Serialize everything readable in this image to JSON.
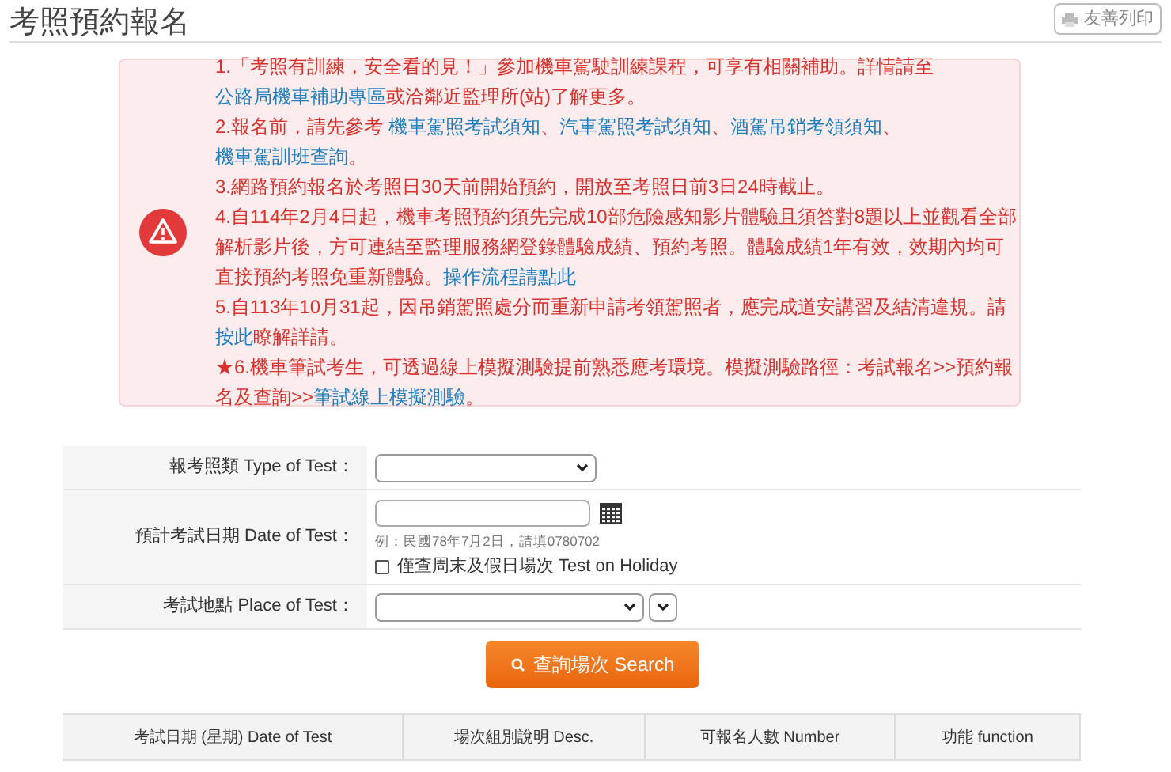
{
  "page": {
    "title": "考照預約報名",
    "print_button": "友善列印"
  },
  "notices": [
    [
      {
        "kind": "text",
        "text": "1.「考照有訓練，安全看的見！」參加機車駕駛訓練課程，可享有相關補助。詳情請至"
      },
      {
        "kind": "link",
        "text": "公路局機車補助專區"
      },
      {
        "kind": "text",
        "text": "或洽鄰近監理所(站)了解更多。"
      }
    ],
    [
      {
        "kind": "text",
        "text": "2.報名前，請先參考 "
      },
      {
        "kind": "link",
        "text": "機車駕照考試須知"
      },
      {
        "kind": "text",
        "text": "、"
      },
      {
        "kind": "link",
        "text": "汽車駕照考試須知"
      },
      {
        "kind": "text",
        "text": "、"
      },
      {
        "kind": "link",
        "text": "酒駕吊銷考領須知"
      },
      {
        "kind": "text",
        "text": "、"
      },
      {
        "kind": "link",
        "text": "機車駕訓班查詢"
      },
      {
        "kind": "text",
        "text": "。"
      }
    ],
    [
      {
        "kind": "text",
        "text": "3.網路預約報名於考照日30天前開始預約，開放至考照日前3日24時截止。"
      }
    ],
    [
      {
        "kind": "text",
        "text": "4.自114年2月4日起，機車考照預約須先完成10部危險感知影片體驗且須答對8題以上並觀看全部解析影片後，方可連結至監理服務網登錄體驗成績、預約考照。體驗成績1年有效，效期內均可直接預約考照免重新體驗。"
      },
      {
        "kind": "link",
        "text": "操作流程請點此"
      }
    ],
    [
      {
        "kind": "text",
        "text": "5.自113年10月31起，因吊銷駕照處分而重新申請考領駕照者，應完成道安講習及結清違規。請"
      },
      {
        "kind": "link",
        "text": "按此"
      },
      {
        "kind": "text",
        "text": "瞭解詳請。"
      }
    ],
    [
      {
        "kind": "text",
        "text": "★6.機車筆試考生，可透過線上模擬測驗提前熟悉應考環境。模擬測驗路徑：考試報名>>預約報名及查詢>>"
      },
      {
        "kind": "link",
        "text": "筆試線上模擬測驗"
      },
      {
        "kind": "text",
        "text": "。"
      }
    ]
  ],
  "form": {
    "type_label": "報考照類 Type of Test：",
    "date_label": "預計考試日期 Date of Test：",
    "date_hint": "例：民國78年7月2日，請填0780702",
    "holiday": {
      "label": "僅查周末及假日場次 Test on Holiday",
      "checked": false
    },
    "place_label": "考試地點 Place of Test：",
    "search_button": "查詢場次 Search"
  },
  "table": {
    "columns": [
      "考試日期 (星期) Date of Test",
      "場次組別說明 Desc.",
      "可報名人數 Number",
      "功能 function"
    ]
  }
}
